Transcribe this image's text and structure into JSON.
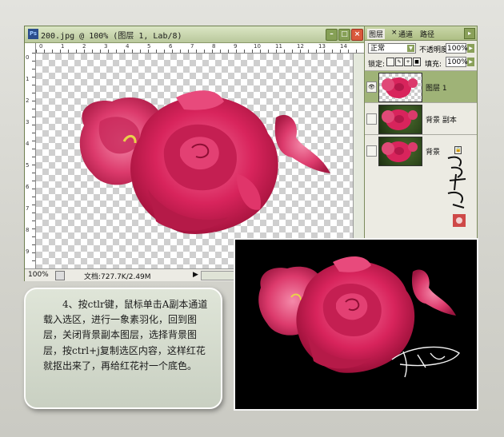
{
  "document_window": {
    "title": "200.jpg @ 100% (图层 1, Lab/8)",
    "app_icon": "Ps",
    "buttons": {
      "minimize": "minimize-icon",
      "maximize": "maximize-icon",
      "close": "close-icon"
    },
    "ruler_top_numbers": [
      "0",
      "1",
      "2",
      "3",
      "4",
      "5",
      "6",
      "7",
      "8",
      "9",
      "10",
      "11",
      "12",
      "13",
      "14"
    ],
    "ruler_left_numbers": [
      "0",
      "1",
      "2",
      "3",
      "4",
      "5",
      "6",
      "7",
      "8",
      "9"
    ],
    "status": {
      "zoom": "100%",
      "doc_info": "文档:727.7K/2.49M",
      "arrow": "▶"
    }
  },
  "layers_panel": {
    "tabs": [
      "图层",
      "通道",
      "路径"
    ],
    "blend_mode": "正常",
    "opacity_label": "不透明度:",
    "opacity_value": "100%",
    "lock_label": "锁定:",
    "fill_label": "填充:",
    "fill_value": "100%",
    "layers": [
      {
        "name": "图层 1",
        "selected": true,
        "visible": true,
        "locked": false
      },
      {
        "name": "背景 副本",
        "selected": false,
        "visible": false,
        "locked": false
      },
      {
        "name": "背景",
        "selected": false,
        "visible": false,
        "locked": true
      }
    ]
  },
  "note": {
    "text": "4、按ctlr键，鼠标单击A副本通道载入选区，进行一象素羽化，回到图层，关闭背景副本图层，选择背景图层，按ctrl+j复制选区内容，这样红花就抠出来了，再给红花衬一个底色。"
  },
  "colors": {
    "rose_main": "#d8245c",
    "rose_light": "#f05a8a",
    "rose_dark": "#9c1038",
    "panel_green": "#9fb377"
  }
}
